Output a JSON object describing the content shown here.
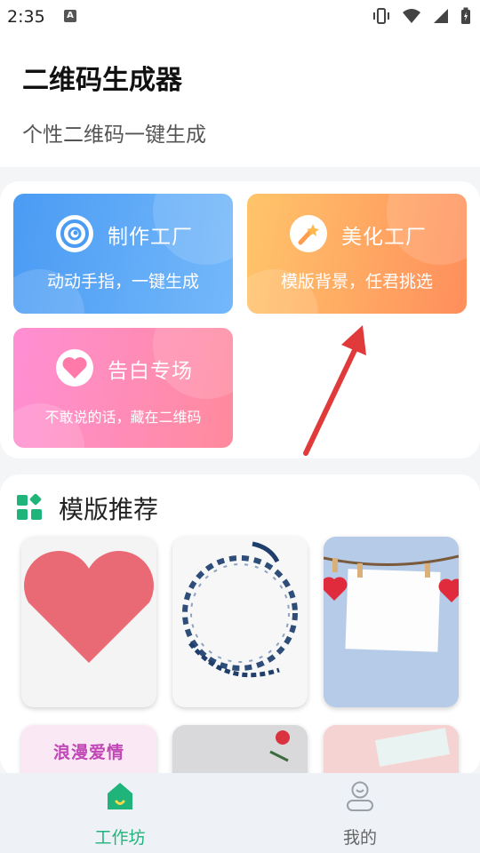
{
  "status_bar": {
    "time": "2:35",
    "notification_icon": "A"
  },
  "header": {
    "title": "二维码生成器",
    "subtitle": "个性二维码一键生成"
  },
  "cards": {
    "make": {
      "title": "制作工厂",
      "subtitle": "动动手指，一键生成",
      "icon": "target-icon"
    },
    "beautify": {
      "title": "美化工厂",
      "subtitle": "模版背景，任君挑选",
      "icon": "magic-wand-icon"
    },
    "love": {
      "title": "告白专场",
      "subtitle": "不敢说的话，藏在二维码",
      "icon": "heart-icon"
    }
  },
  "templates": {
    "title": "模版推荐",
    "items": [
      {
        "label": ""
      },
      {
        "label": ""
      },
      {
        "label": ""
      },
      {
        "label": "浪漫爱情"
      },
      {
        "label": ""
      },
      {
        "label": ""
      }
    ]
  },
  "tabbar": {
    "tabs": [
      {
        "label": "工作坊",
        "icon": "home-icon",
        "active": true
      },
      {
        "label": "我的",
        "icon": "user-icon",
        "active": false
      }
    ]
  },
  "colors": {
    "accent_green": "#1fb57a",
    "make_card": "#4a9bf4",
    "beautify_card": "#ff9c5e",
    "love_card": "#ff8fd4",
    "arrow": "#e03a3a"
  }
}
